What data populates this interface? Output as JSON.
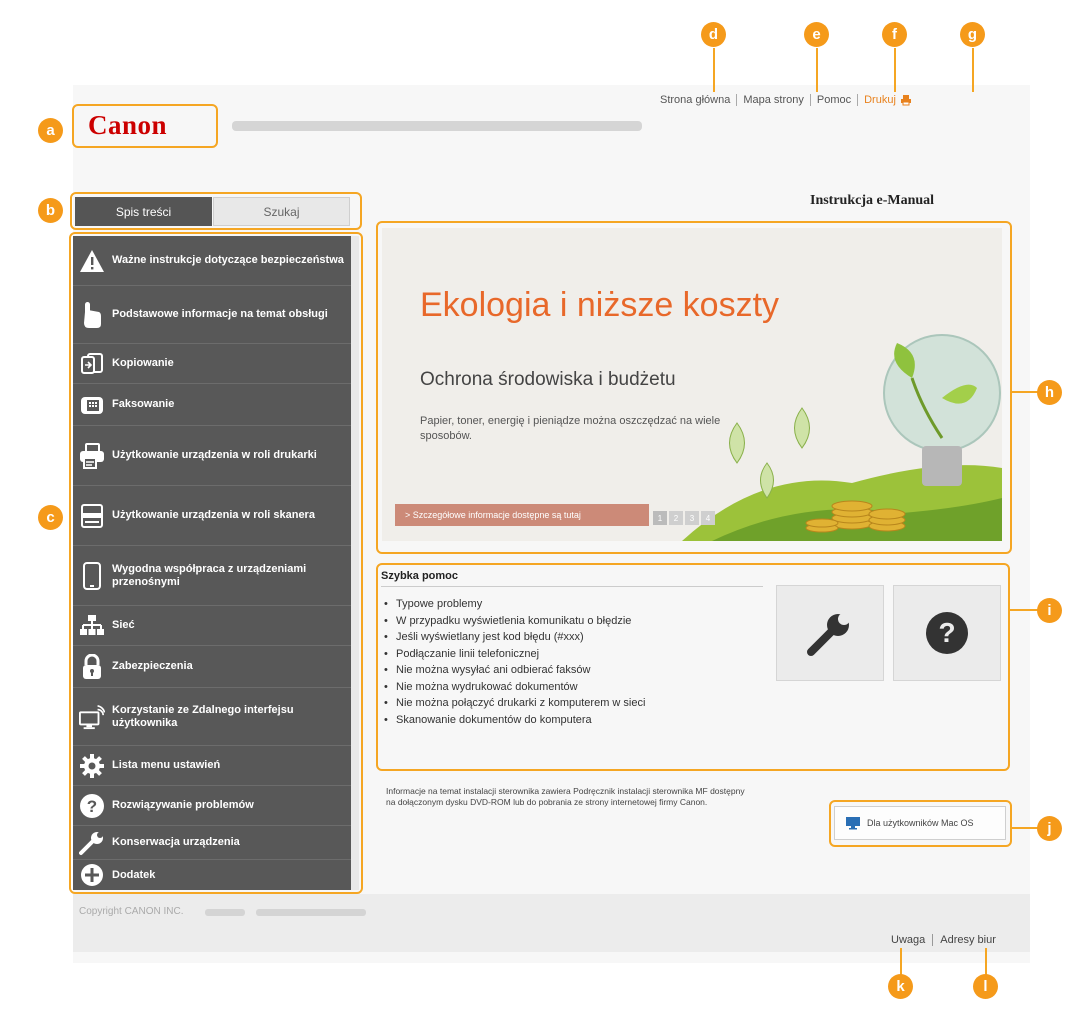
{
  "header": {
    "logo_text": "Canon",
    "top_links": [
      "Strona główna",
      "Mapa strony",
      "Pomoc"
    ],
    "print_label": "Drukuj",
    "manual_title": "Instrukcja e-Manual"
  },
  "tabs": {
    "active": "Spis treści",
    "inactive": "Szukaj"
  },
  "toc": [
    {
      "label": "Ważne instrukcje dotyczące bezpieczeństwa",
      "icon": "warning-icon"
    },
    {
      "label": "Podstawowe informacje na temat obsługi",
      "icon": "hand-icon"
    },
    {
      "label": "Kopiowanie",
      "icon": "copy-icon"
    },
    {
      "label": "Faksowanie",
      "icon": "fax-icon"
    },
    {
      "label": "Użytkowanie urządzenia w roli drukarki",
      "icon": "printer-icon"
    },
    {
      "label": "Użytkowanie urządzenia w roli skanera",
      "icon": "scanner-icon"
    },
    {
      "label": "Wygodna współpraca z urządzeniami przenośnymi",
      "icon": "smartphone-icon"
    },
    {
      "label": "Sieć",
      "icon": "network-icon"
    },
    {
      "label": "Zabezpieczenia",
      "icon": "lock-icon"
    },
    {
      "label": "Korzystanie ze Zdalnego interfejsu użytkownika",
      "icon": "remote-ui-icon"
    },
    {
      "label": "Lista menu ustawień",
      "icon": "gear-icon"
    },
    {
      "label": "Rozwiązywanie problemów",
      "icon": "question-icon"
    },
    {
      "label": "Konserwacja urządzenia",
      "icon": "wrench-icon"
    },
    {
      "label": "Dodatek",
      "icon": "plus-icon"
    }
  ],
  "banner": {
    "headline": "Ekologia i niższe koszty",
    "subheadline": "Ochrona środowiska i budżetu",
    "text": "Papier, toner, energię i pieniądze można oszczędzać na wiele sposobów.",
    "more_link": "> Szczegółowe informacje dostępne są tutaj",
    "pages": [
      "1",
      "2",
      "3",
      "4"
    ]
  },
  "quick_help": {
    "title": "Szybka pomoc",
    "items": [
      "Typowe problemy",
      "W przypadku wyświetlenia komunikatu o błędzie",
      "Jeśli wyświetlany jest kod błędu (#xxx)",
      "Podłączanie linii telefonicznej",
      "Nie można wysyłać ani odbierać faksów",
      "Nie można wydrukować dokumentów",
      "Nie można połączyć drukarki z komputerem w sieci",
      "Skanowanie dokumentów do komputera"
    ]
  },
  "driver_note": "Informacje na temat instalacji sterownika zawiera Podręcznik instalacji sterownika MF dostępny na dołączonym dysku DVD-ROM lub do pobrania ze strony internetowej firmy Canon.",
  "mac_button": "Dla użytkowników Mac OS",
  "footer": {
    "copyright": "Copyright CANON INC.",
    "links": [
      "Uwaga",
      "Adresy biur"
    ]
  },
  "callouts": {
    "a": "a",
    "b": "b",
    "c": "c",
    "d": "d",
    "e": "e",
    "f": "f",
    "g": "g",
    "h": "h",
    "i": "i",
    "j": "j",
    "k": "k",
    "l": "l"
  },
  "colors": {
    "accent": "#f5a623",
    "brand": "#cc0000",
    "toc_bg": "#585858",
    "banner_headline": "#e8682a"
  }
}
